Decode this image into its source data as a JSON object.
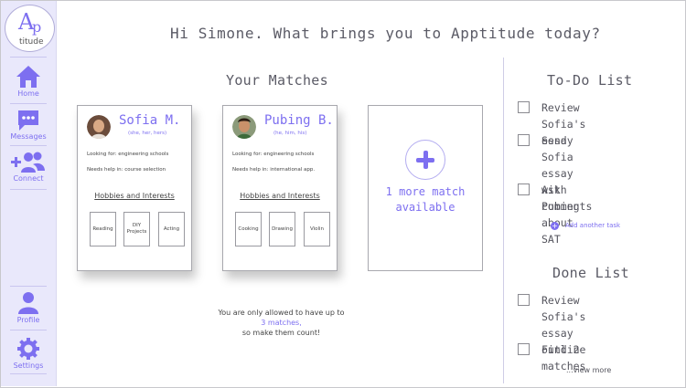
{
  "app": {
    "logo_letter": "A",
    "logo_letter2": "p",
    "logo_word": "titude",
    "greeting": "Hi Simone. What brings you to Apptitude today?"
  },
  "sidebar": {
    "items": [
      {
        "label": "Home",
        "icon": "home-icon"
      },
      {
        "label": "Messages",
        "icon": "messages-icon"
      },
      {
        "label": "Connect",
        "icon": "connect-icon"
      },
      {
        "label": "Profile",
        "icon": "profile-icon"
      },
      {
        "label": "Settings",
        "icon": "settings-icon"
      }
    ]
  },
  "matches": {
    "title": "Your Matches",
    "cards": [
      {
        "name": "Sofia M.",
        "pronouns": "(she, her, hers)",
        "looking_for": "Looking for: engineering schools",
        "needs_help": "Needs help in: course selection",
        "hobbies_title": "Hobbies and Interests",
        "hobbies": [
          "Reading",
          "DIY Projects",
          "Acting"
        ]
      },
      {
        "name": "Pubing B.",
        "pronouns": "(he, him, his)",
        "looking_for": "Looking for: engineering schools",
        "needs_help": "Needs help in: international app.",
        "hobbies_title": "Hobbies and Interests",
        "hobbies": [
          "Cooking",
          "Drawing",
          "Violin"
        ]
      }
    ],
    "more": {
      "line1": "1 more match",
      "line2": "available"
    },
    "notice": {
      "line1": "You are only allowed to have up to",
      "highlight": "3 matches,",
      "line3": "so make them count!"
    }
  },
  "todo": {
    "title": "To-Do List",
    "items": [
      {
        "line1": "Review Sofia's essay",
        "line2": ""
      },
      {
        "line1": "Send Sofia essay",
        "line2": "with comments"
      },
      {
        "line1": "Ask Pubing about",
        "line2": "SAT"
      }
    ],
    "add_task": "Add another task"
  },
  "done": {
    "title": "Done List",
    "items": [
      {
        "line1": "Review Sofia's essay",
        "line2": "outline"
      },
      {
        "line1": "Find 2 matches",
        "line2": ""
      }
    ],
    "view_more": "...view more"
  },
  "colors": {
    "accent": "#7d6ff0",
    "sidebar_bg": "#e9e8fb"
  }
}
